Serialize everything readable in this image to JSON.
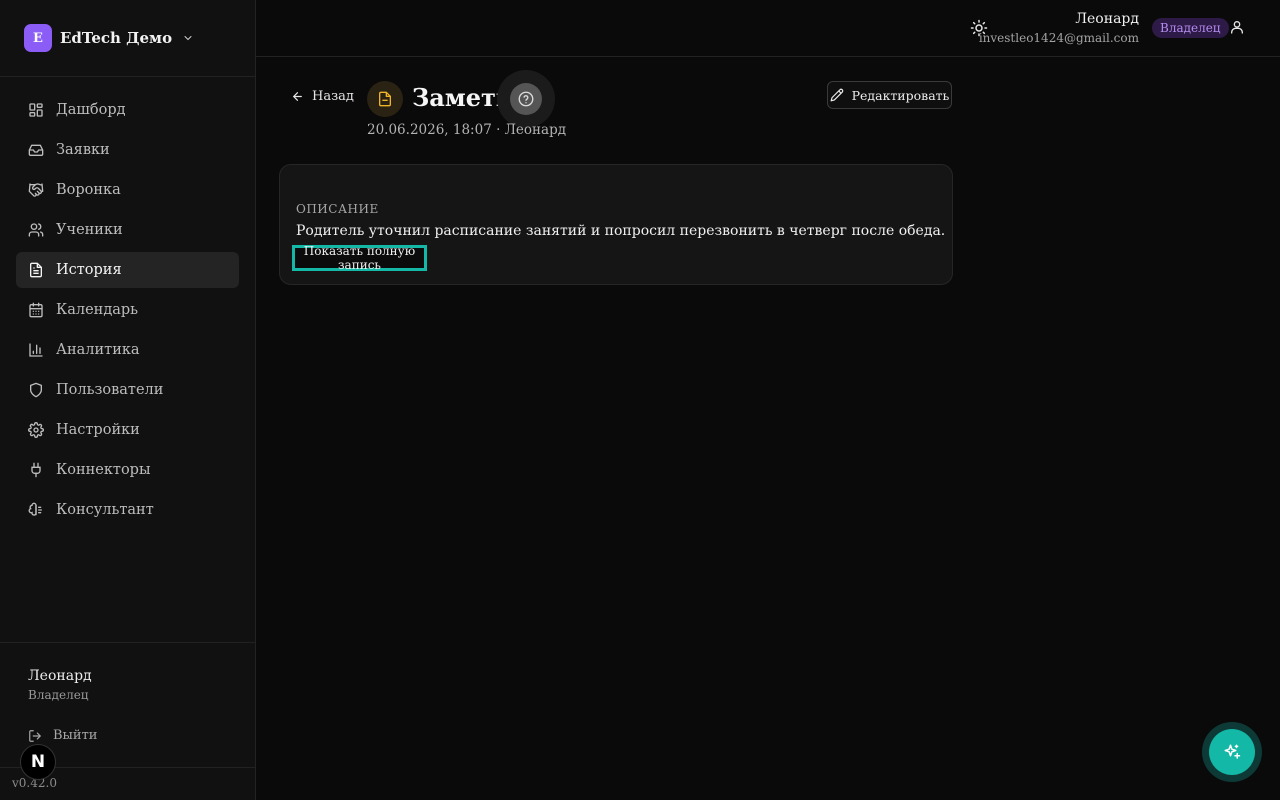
{
  "workspace": {
    "logo_letter": "E",
    "name": "EdTech Демо"
  },
  "sidebar": {
    "items": [
      {
        "label": "Дашборд",
        "icon": "dashboard-icon",
        "active": false
      },
      {
        "label": "Заявки",
        "icon": "inbox-icon",
        "active": false
      },
      {
        "label": "Воронка",
        "icon": "handshake-icon",
        "active": false
      },
      {
        "label": "Ученики",
        "icon": "users-icon",
        "active": false
      },
      {
        "label": "История",
        "icon": "file-text-icon",
        "active": true
      },
      {
        "label": "Календарь",
        "icon": "calendar-icon",
        "active": false
      },
      {
        "label": "Аналитика",
        "icon": "bar-chart-icon",
        "active": false
      },
      {
        "label": "Пользователи",
        "icon": "shield-icon",
        "active": false
      },
      {
        "label": "Настройки",
        "icon": "gear-icon",
        "active": false
      },
      {
        "label": "Коннекторы",
        "icon": "plug-icon",
        "active": false
      },
      {
        "label": "Консультант",
        "icon": "brain-icon",
        "active": false
      }
    ],
    "user": {
      "name": "Леонард",
      "role": "Владелец"
    },
    "logout_label": "Выйти",
    "version": "v0.42.0",
    "next_badge": "N"
  },
  "topbar": {
    "user_name": "Леонард",
    "user_email": "investleo1424@gmail.com",
    "role_badge": "Владелец"
  },
  "page": {
    "back_label": "Назад",
    "title": "Заметка",
    "meta": "20.06.2026, 18:07 · Леонард",
    "edit_label": "Редактировать"
  },
  "card": {
    "label": "ОПИСАНИЕ",
    "text": "Родитель уточнил расписание занятий и попросил перезвонить в четверг после обеда.",
    "show_full_label": "Показать полную запись"
  },
  "colors": {
    "accent_teal": "#14b8a6",
    "workspace_logo": "#8b5cf6",
    "note_icon": "#f0b429",
    "role_badge_text": "#b58cf0"
  }
}
